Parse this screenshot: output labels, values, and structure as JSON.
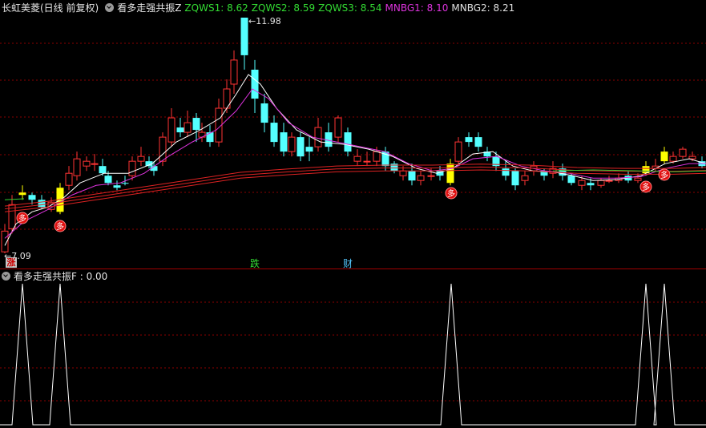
{
  "top_panel": {
    "stock_name": "长虹美菱(日线 前复权)",
    "indicator_name": "看多走强共振Z",
    "values": [
      {
        "label": "ZQWS1: 8.62",
        "color": "#33dd33"
      },
      {
        "label": "ZQWS2: 8.59",
        "color": "#33dd33"
      },
      {
        "label": "ZQWS3: 8.54",
        "color": "#33dd33"
      },
      {
        "label": "MNBG1: 8.10",
        "color": "#dd33dd"
      },
      {
        "label": "MNBG2: 8.21",
        "color": "#e0e0e0"
      }
    ],
    "high_label": "11.98",
    "low_label": "7.09",
    "markers": {
      "zhang": "涨",
      "die": "跌",
      "cai": "财",
      "duo": "多"
    }
  },
  "bottom_panel": {
    "indicator_label": "看多走强共振F : 0.00"
  },
  "colors": {
    "up": "#ff3333",
    "down": "#54ffff",
    "signal": "#ffff00",
    "ma_white": "#ffffff",
    "ma_magenta": "#dd33dd",
    "ma_red": "#dd2222",
    "ma_green": "#33cc33"
  },
  "chart_data": {
    "type": "candlestick",
    "y_high": 11.98,
    "y_low": 7.09,
    "signal_candle_indices": [
      1,
      5,
      62,
      89,
      92
    ],
    "oscillator_peaks_at_candles": [
      1,
      5,
      62,
      89,
      92
    ]
  }
}
